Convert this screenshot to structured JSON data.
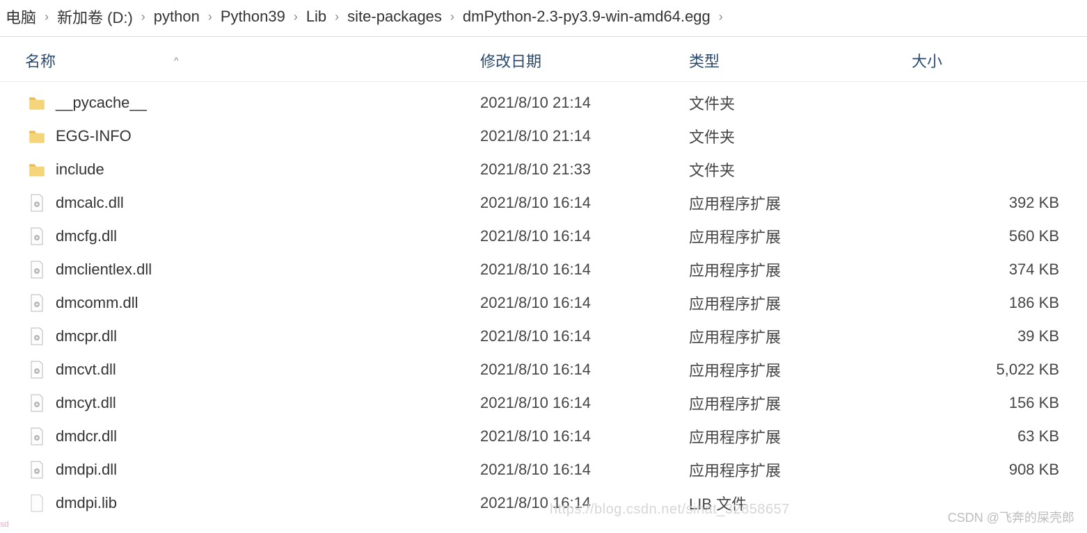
{
  "breadcrumb": {
    "segments": [
      "电脑",
      "新加卷 (D:)",
      "python",
      "Python39",
      "Lib",
      "site-packages",
      "dmPython-2.3-py3.9-win-amd64.egg"
    ]
  },
  "columns": {
    "name": "名称",
    "date": "修改日期",
    "type": "类型",
    "size": "大小"
  },
  "sort_caret": "^",
  "files": [
    {
      "icon": "folder",
      "name": "__pycache__",
      "date": "2021/8/10 21:14",
      "type": "文件夹",
      "size": ""
    },
    {
      "icon": "folder",
      "name": "EGG-INFO",
      "date": "2021/8/10 21:14",
      "type": "文件夹",
      "size": ""
    },
    {
      "icon": "folder",
      "name": "include",
      "date": "2021/8/10 21:33",
      "type": "文件夹",
      "size": ""
    },
    {
      "icon": "dll",
      "name": "dmcalc.dll",
      "date": "2021/8/10 16:14",
      "type": "应用程序扩展",
      "size": "392 KB"
    },
    {
      "icon": "dll",
      "name": "dmcfg.dll",
      "date": "2021/8/10 16:14",
      "type": "应用程序扩展",
      "size": "560 KB"
    },
    {
      "icon": "dll",
      "name": "dmclientlex.dll",
      "date": "2021/8/10 16:14",
      "type": "应用程序扩展",
      "size": "374 KB"
    },
    {
      "icon": "dll",
      "name": "dmcomm.dll",
      "date": "2021/8/10 16:14",
      "type": "应用程序扩展",
      "size": "186 KB"
    },
    {
      "icon": "dll",
      "name": "dmcpr.dll",
      "date": "2021/8/10 16:14",
      "type": "应用程序扩展",
      "size": "39 KB"
    },
    {
      "icon": "dll",
      "name": "dmcvt.dll",
      "date": "2021/8/10 16:14",
      "type": "应用程序扩展",
      "size": "5,022 KB"
    },
    {
      "icon": "dll",
      "name": "dmcyt.dll",
      "date": "2021/8/10 16:14",
      "type": "应用程序扩展",
      "size": "156 KB"
    },
    {
      "icon": "dll",
      "name": "dmdcr.dll",
      "date": "2021/8/10 16:14",
      "type": "应用程序扩展",
      "size": "63 KB"
    },
    {
      "icon": "dll",
      "name": "dmdpi.dll",
      "date": "2021/8/10 16:14",
      "type": "应用程序扩展",
      "size": "908 KB"
    },
    {
      "icon": "file",
      "name": "dmdpi.lib",
      "date": "2021/8/10 16:14",
      "type": "LIB 文件",
      "size": ""
    }
  ],
  "watermark": {
    "csdn_url_partial": "https://blog.csdn.net/sinat_32858657",
    "csdn_credit": "CSDN @飞奔的屎壳郎",
    "sd": "sd"
  },
  "icon_names": {
    "folder": "folder-icon",
    "dll": "dll-file-icon",
    "file": "generic-file-icon",
    "chevron": "chevron-right-icon",
    "caret": "sort-ascending-icon"
  }
}
